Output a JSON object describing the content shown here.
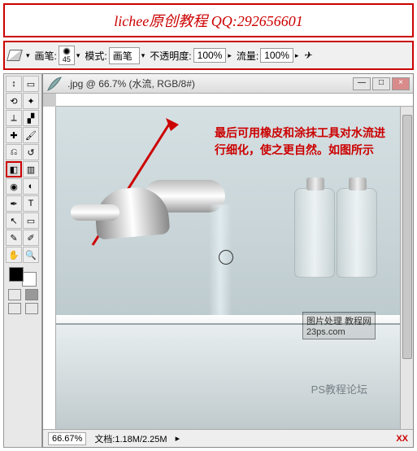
{
  "banner": {
    "text": "lichee原创教程 QQ:292656601"
  },
  "options": {
    "brush_label": "画笔:",
    "brush_size": "45",
    "mode_label": "模式:",
    "mode_value": "画笔",
    "opacity_label": "不透明度:",
    "opacity_value": "100%",
    "flow_label": "流量:",
    "flow_value": "100%"
  },
  "window": {
    "title": ".jpg @ 66.7% (水流, RGB/8#)",
    "min": "—",
    "max": "□",
    "close": "×"
  },
  "annotation": {
    "line1": "最后可用橡皮和涂抹工具对水流进",
    "line2": "行细化，使之更自然。如图所示"
  },
  "watermark1": {
    "l1": "图片处理",
    "l2": "23ps.com",
    "l3": "教程网"
  },
  "watermark2": "PS教程论坛",
  "status": {
    "zoom": "66.67%",
    "doc": "文档:1.18M/2.25M",
    "xx": "XX"
  },
  "tools": {
    "move": "↕",
    "marquee": "▭",
    "lasso": "⟲",
    "wand": "✦",
    "crop": "⟂",
    "slice": "▞",
    "heal": "✚",
    "brush": "🖌",
    "stamp": "⎌",
    "history": "↺",
    "eraser": "◧",
    "grad": "▥",
    "blur": "◉",
    "dodge": "◐",
    "pen": "✒",
    "type": "T",
    "path": "↖",
    "shape": "▭",
    "note": "✎",
    "eyedrop": "✐",
    "hand": "✋",
    "zoom": "🔍"
  }
}
